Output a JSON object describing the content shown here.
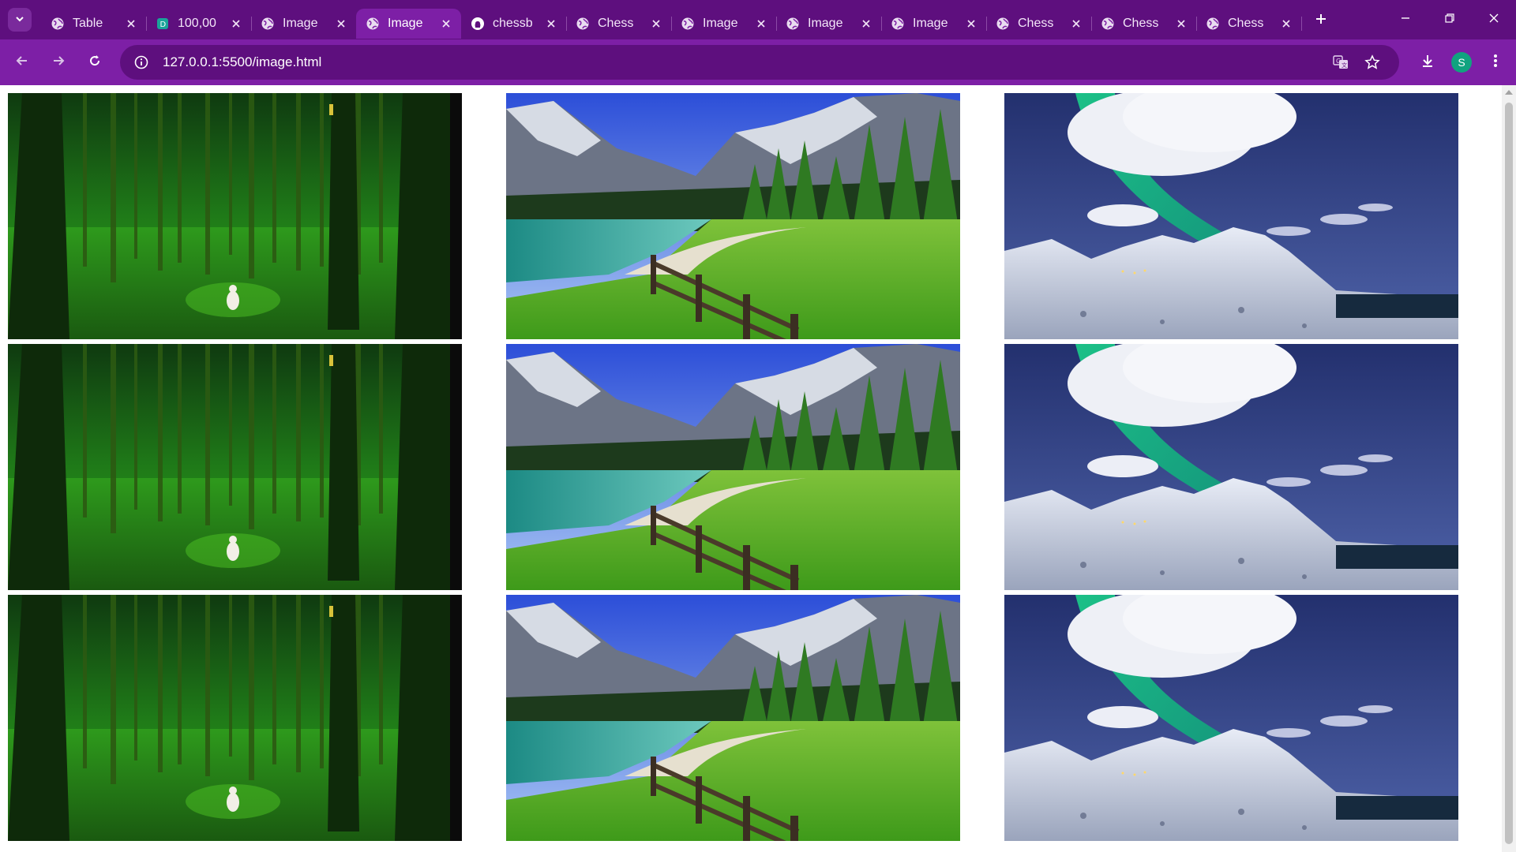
{
  "browser": {
    "tabs": [
      {
        "label": "Table",
        "favicon": "globe-icon",
        "active": false
      },
      {
        "label": "100,00",
        "favicon": "document-icon",
        "active": false
      },
      {
        "label": "Image",
        "favicon": "globe-icon",
        "active": false
      },
      {
        "label": "Image",
        "favicon": "globe-icon",
        "active": true
      },
      {
        "label": "chessb",
        "favicon": "github-icon",
        "active": false
      },
      {
        "label": "Chess",
        "favicon": "globe-icon",
        "active": false
      },
      {
        "label": "Image",
        "favicon": "globe-icon",
        "active": false
      },
      {
        "label": "Image",
        "favicon": "globe-icon",
        "active": false
      },
      {
        "label": "Image",
        "favicon": "globe-icon",
        "active": false
      },
      {
        "label": "Chess",
        "favicon": "globe-icon",
        "active": false
      },
      {
        "label": "Chess",
        "favicon": "globe-icon",
        "active": false
      },
      {
        "label": "Chess",
        "favicon": "globe-icon",
        "active": false
      }
    ],
    "address": {
      "url": "127.0.0.1:5500/image.html"
    },
    "profile": {
      "initial": "S"
    },
    "colors": {
      "frame": "#5e0f7e",
      "toolbar": "#7d1fa6",
      "avatar": "#10a37f"
    }
  },
  "gallery": {
    "rows": [
      [
        "forest",
        "mountain-lake",
        "aurora"
      ],
      [
        "forest",
        "mountain-lake",
        "aurora"
      ],
      [
        "forest",
        "mountain-lake",
        "aurora"
      ]
    ]
  }
}
